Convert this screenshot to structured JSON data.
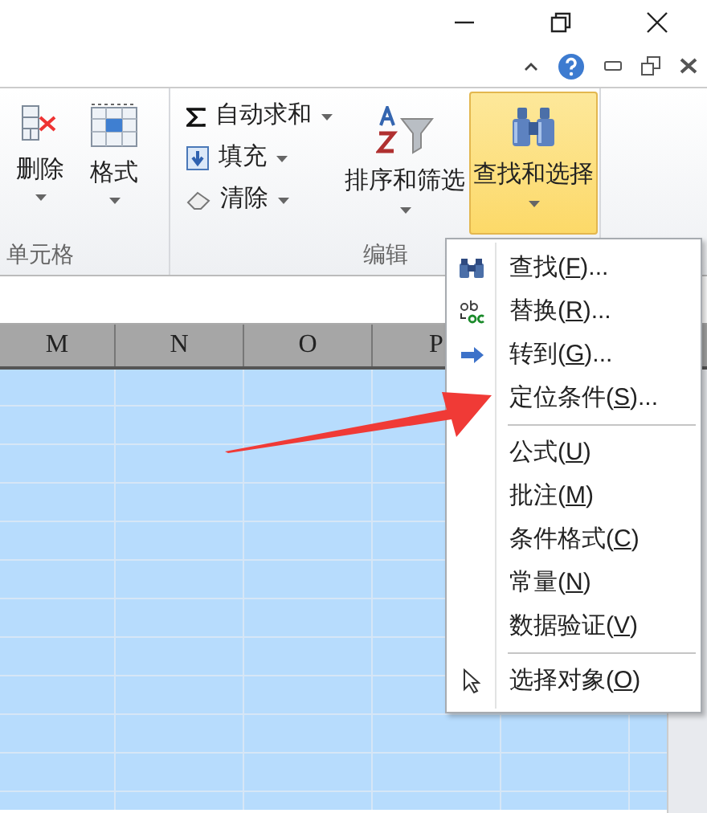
{
  "ribbon": {
    "cells_group": {
      "buttons": [
        {
          "label": "删除"
        },
        {
          "label": "格式"
        }
      ],
      "label": "单元格"
    },
    "editing_group": {
      "small_buttons": [
        {
          "label": "自动求和"
        },
        {
          "label": "填充"
        },
        {
          "label": "清除"
        }
      ],
      "large_buttons": [
        {
          "label": "排序和筛选",
          "selected": false
        },
        {
          "label": "查找和选择",
          "selected": true
        }
      ],
      "label": "编辑"
    }
  },
  "sheet": {
    "columns": [
      "M",
      "N",
      "O",
      "P"
    ]
  },
  "menu": {
    "items": [
      {
        "label": "查找(",
        "key": "F",
        "rest": ")...",
        "separator_before": false
      },
      {
        "label": "替换(",
        "key": "R",
        "rest": ")...",
        "separator_before": false
      },
      {
        "label": "转到(",
        "key": "G",
        "rest": ")...",
        "separator_before": false
      },
      {
        "label": "定位条件(",
        "key": "S",
        "rest": ")...",
        "separator_before": false
      },
      {
        "label": "公式(",
        "key": "U",
        "rest": ")",
        "separator_before": true
      },
      {
        "label": "批注(",
        "key": "M",
        "rest": ")",
        "separator_before": false
      },
      {
        "label": "条件格式(",
        "key": "C",
        "rest": ")",
        "separator_before": false
      },
      {
        "label": "常量(",
        "key": "N",
        "rest": ")",
        "separator_before": false
      },
      {
        "label": "数据验证(",
        "key": "V",
        "rest": ")",
        "separator_before": false
      },
      {
        "label": "选择对象(",
        "key": "O",
        "rest": ")",
        "separator_before": true
      }
    ]
  }
}
